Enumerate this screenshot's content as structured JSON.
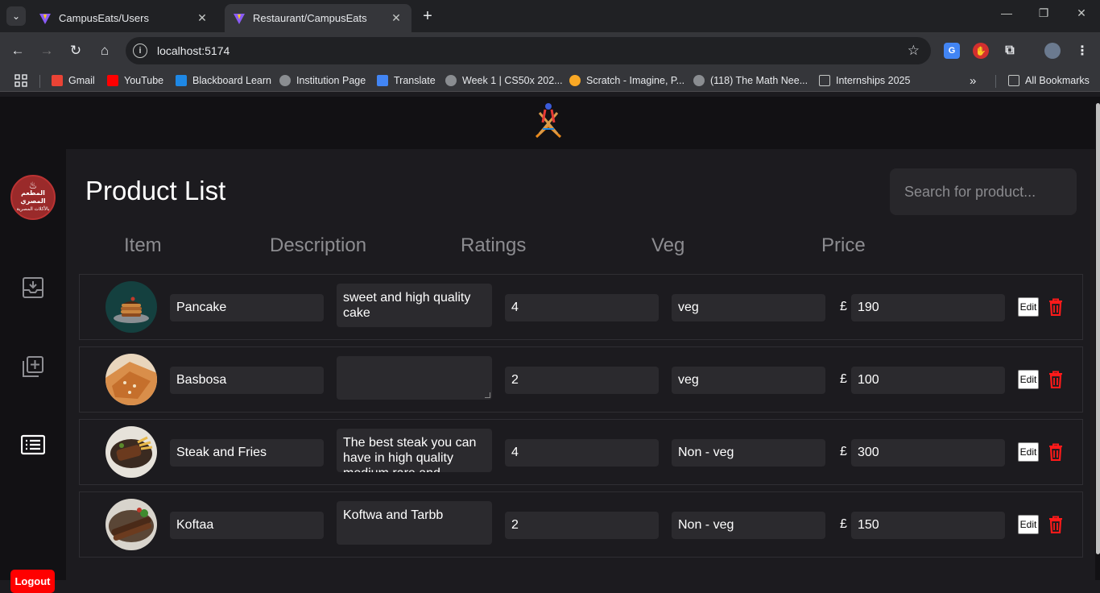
{
  "browser": {
    "tabs": [
      {
        "title": "CampusEats/Users",
        "active": false
      },
      {
        "title": "Restaurant/CampusEats",
        "active": true
      }
    ],
    "url": "localhost:5174",
    "bookmarks": [
      {
        "label": "Gmail",
        "icon": "gmail-icon",
        "color": "#ea4335"
      },
      {
        "label": "YouTube",
        "icon": "youtube-icon",
        "color": "#ff0000"
      },
      {
        "label": "Blackboard Learn",
        "icon": "blackboard-icon",
        "color": "#1e88e5"
      },
      {
        "label": "Institution Page",
        "icon": "globe-icon",
        "color": "#c4c7c5"
      },
      {
        "label": "Translate",
        "icon": "translate-icon",
        "color": "#4285f4"
      },
      {
        "label": "Week 1 | CS50x 202...",
        "icon": "globe-icon",
        "color": "#c4c7c5"
      },
      {
        "label": "Scratch - Imagine, P...",
        "icon": "scratch-icon",
        "color": "#f9a825"
      },
      {
        "label": "(118) The Math Nee...",
        "icon": "globe-icon",
        "color": "#c4c7c5"
      },
      {
        "label": "Internships 2025",
        "icon": "folder-icon",
        "color": "#c4c7c5"
      }
    ],
    "all_bookmarks": "All Bookmarks"
  },
  "sidebar": {
    "logo_text": "المطعم المصري",
    "logo_subtext": "بالأكلات المصرية",
    "logout_label": "Logout"
  },
  "page": {
    "title": "Product List",
    "search_placeholder": "Search for product..."
  },
  "columns": [
    "Item",
    "Description",
    "Ratings",
    "Veg",
    "Price"
  ],
  "products": [
    {
      "name": "Pancake",
      "description": "sweet and high quality cake",
      "rating": "4",
      "veg": "veg",
      "currency": "£",
      "price": "190",
      "edit_label": "Edit"
    },
    {
      "name": "Basbosa",
      "description": "",
      "rating": "2",
      "veg": "veg",
      "currency": "£",
      "price": "100",
      "edit_label": "Edit"
    },
    {
      "name": "Steak and Fries",
      "description": "The best steak you can have in high quality medium rare and",
      "rating": "4",
      "veg": "Non - veg",
      "currency": "£",
      "price": "300",
      "edit_label": "Edit"
    },
    {
      "name": "Koftaa",
      "description": "Koftwa and Tarbb",
      "rating": "2",
      "veg": "Non - veg",
      "currency": "£",
      "price": "150",
      "edit_label": "Edit"
    }
  ],
  "colors": {
    "accent_red": "#ff0000",
    "background": "#1c1b1f",
    "sidebar": "#121114"
  }
}
